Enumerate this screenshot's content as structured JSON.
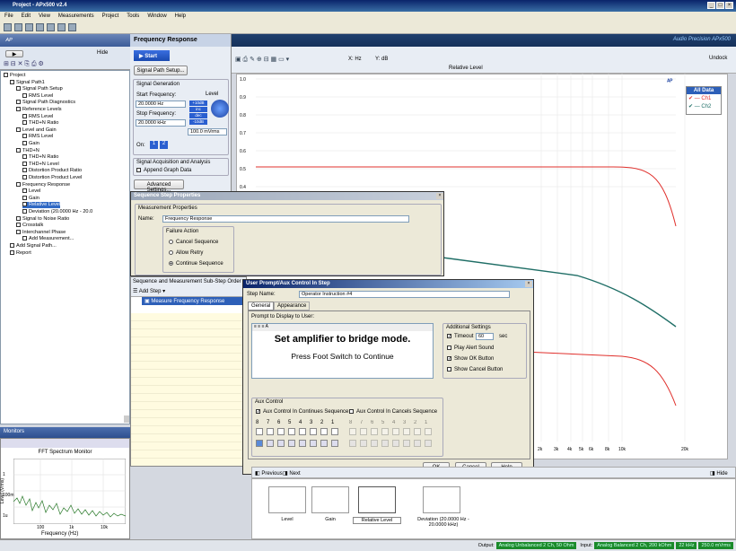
{
  "window": {
    "title": "Project - APx500 v2.4"
  },
  "menu": [
    "File",
    "Edit",
    "View",
    "Measurements",
    "Project",
    "Tools",
    "Window",
    "Help"
  ],
  "left": {
    "hide_label": "Hide",
    "tree": [
      {
        "label": "Project",
        "indent": 0
      },
      {
        "label": "Signal Path1",
        "indent": 1
      },
      {
        "label": "Signal Path Setup",
        "indent": 2
      },
      {
        "label": "RMS Level",
        "indent": 3
      },
      {
        "label": "Signal Path Diagnostics",
        "indent": 2
      },
      {
        "label": "Reference Levels",
        "indent": 2
      },
      {
        "label": "RMS Level",
        "indent": 3
      },
      {
        "label": "THD+N Ratio",
        "indent": 3
      },
      {
        "label": "Level and Gain",
        "indent": 2
      },
      {
        "label": "RMS Level",
        "indent": 3
      },
      {
        "label": "Gain",
        "indent": 3
      },
      {
        "label": "THD+N",
        "indent": 2
      },
      {
        "label": "THD+N Ratio",
        "indent": 3
      },
      {
        "label": "THD+N Level",
        "indent": 3
      },
      {
        "label": "Distortion Product Ratio",
        "indent": 3
      },
      {
        "label": "Distortion Product Level",
        "indent": 3
      },
      {
        "label": "Frequency Response",
        "indent": 2
      },
      {
        "label": "Level",
        "indent": 3
      },
      {
        "label": "Gain",
        "indent": 3
      },
      {
        "label": "Relative Level",
        "indent": 3,
        "selected": true
      },
      {
        "label": "Deviation (20.0000 Hz - 20.0",
        "indent": 3
      },
      {
        "label": "Signal to Noise Ratio",
        "indent": 2
      },
      {
        "label": "Crosstalk",
        "indent": 2
      },
      {
        "label": "Interchannel Phase",
        "indent": 2
      },
      {
        "label": "Add Measurement...",
        "indent": 3
      },
      {
        "label": "Add Signal Path...",
        "indent": 1
      },
      {
        "label": "Report",
        "indent": 1
      }
    ]
  },
  "monitors": {
    "title": "Monitors",
    "chart_title": "FFT Spectrum Monitor",
    "ylabel": "Level (Vrms)",
    "xlabel": "Frequency (Hz)",
    "yticks": [
      "1",
      "100m",
      "1u"
    ],
    "xticks": [
      "100",
      "1k",
      "10k"
    ]
  },
  "panel": {
    "header": "Frequency Response",
    "start": "Start",
    "setup": "Signal Path Setup...",
    "gen_title": "Signal Generation",
    "start_freq_label": "Start Frequency:",
    "start_freq": "20.0000 Hz",
    "level_label": "Level",
    "stop_freq_label": "Stop Frequency:",
    "stop_freq": "20.0000 kHz",
    "level_value": "100.0 mVrms",
    "btn_up10": "+10dB",
    "btn_inc": "inc",
    "btn_dec": "dec",
    "btn_dn10": "-10dB",
    "on_label": "On:",
    "ch1": "1",
    "ch2": "2",
    "acq_title": "Signal Acquisition and Analysis",
    "append": "Append Graph Data",
    "adv": "Advanced Settings..."
  },
  "graph": {
    "brand": "Audio Precision APx500",
    "undock": "Undock",
    "toolbar_x": "X: Hz",
    "toolbar_y": "Y: dB",
    "title": "Relative Level",
    "legend_title": "All Data",
    "legend": [
      "Ch1",
      "Ch2"
    ],
    "yticks": [
      "1.0",
      "0.9",
      "0.8",
      "0.7",
      "0.6",
      "0.5",
      "0.4"
    ],
    "xticks": [
      "2k",
      "3k",
      "4k",
      "5k",
      "6k",
      "8k",
      "10k",
      "20k"
    ],
    "colors": {
      "ch1": "#e0302c",
      "ch2": "#1f6e66"
    }
  },
  "seq_props": {
    "title": "Sequence Step Properties",
    "group": "Measurement Properties",
    "name_label": "Name:",
    "name_value": "Frequency Response",
    "failure": "Failure Action",
    "opts": [
      "Cancel Sequence",
      "Allow Retry",
      "Continue Sequence"
    ],
    "selected": 2
  },
  "substep": {
    "title": "Sequence and Measurement Sub-Step Order",
    "add_step": "Add Step",
    "item": "Measure Frequency Response"
  },
  "prompt": {
    "title": "User Prompt/Aux Control In Step",
    "step_name_label": "Step Name:",
    "step_name": "Operator Instruction #4",
    "tabs": [
      "General",
      "Appearance"
    ],
    "prompt_label": "Prompt to Display to User:",
    "line1": "Set amplifier to bridge mode.",
    "line2": "Press Foot Switch to Continue",
    "addl": "Additional Settings",
    "timeout": "Timeout",
    "timeout_val": "60",
    "sec": "sec",
    "play": "Play Alert Sound",
    "showok": "Show OK Button",
    "showcancel": "Show Cancel Button",
    "aux": "Aux Control",
    "aux_cont": "Aux Control In Continues Sequence",
    "aux_cancel": "Aux Control In Cancels Sequence",
    "bits": [
      "8",
      "7",
      "6",
      "5",
      "4",
      "3",
      "2",
      "1"
    ],
    "ok": "OK",
    "cancel": "Cancel",
    "help": "Help"
  },
  "thumbs": {
    "prev": "Previous",
    "next": "Next",
    "hide": "Hide",
    "items": [
      "Level",
      "Gain",
      "Relative Level",
      "Deviation (20.0000 Hz - 20.0000 kHz)"
    ]
  },
  "status": {
    "output_label": "Output:",
    "output": "Analog Unbalanced 2 Ch, 50 Ohm",
    "input_label": "Input:",
    "input": "Analog Balanced 2 Ch, 200 kOhm",
    "bw": "22 kHz",
    "level": "250.0 mVrms"
  }
}
